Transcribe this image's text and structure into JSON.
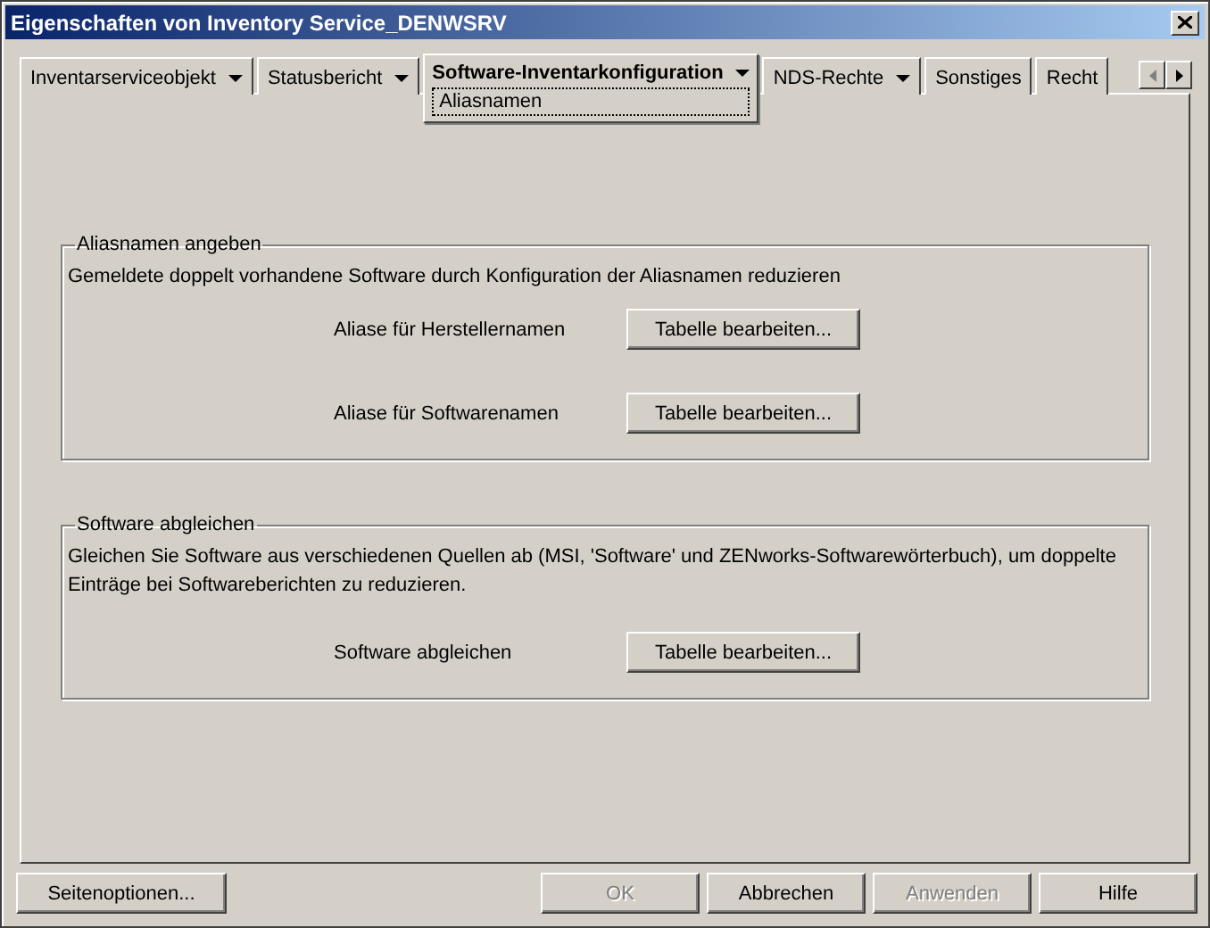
{
  "window": {
    "title": "Eigenschaften von Inventory Service_DENWSRV"
  },
  "tabs": [
    {
      "label": "Inventarserviceobjekt",
      "selected": false,
      "dropdown": true
    },
    {
      "label": "Statusbericht",
      "selected": false,
      "dropdown": true
    },
    {
      "label": "Software-Inventarkonfiguration",
      "selected": true,
      "dropdown": true,
      "subpages": [
        "Aliasnamen"
      ]
    },
    {
      "label": "NDS-Rechte",
      "selected": false,
      "dropdown": true
    },
    {
      "label": "Sonstiges",
      "selected": false,
      "dropdown": false
    },
    {
      "label": "Recht",
      "selected": false,
      "dropdown": false
    }
  ],
  "groups": [
    {
      "title": "Aliasnamen angeben",
      "description": "Gemeldete doppelt vorhandene Software durch Konfiguration der Aliasnamen reduzieren",
      "rows": [
        {
          "label": "Aliase für Herstellernamen",
          "button": "Tabelle bearbeiten..."
        },
        {
          "label": "Aliase für Softwarenamen",
          "button": "Tabelle bearbeiten..."
        }
      ]
    },
    {
      "title": "Software abgleichen",
      "description": "Gleichen Sie Software aus verschiedenen Quellen ab (MSI, 'Software' und ZENworks-Softwarewörterbuch), um doppelte Einträge bei Softwareberichten zu reduzieren.",
      "rows": [
        {
          "label": "Software abgleichen",
          "button": "Tabelle bearbeiten..."
        }
      ]
    }
  ],
  "page_options_button": {
    "label": "Seitenoptionen..."
  },
  "buttons": [
    {
      "label": "OK",
      "disabled": true
    },
    {
      "label": "Abbrechen",
      "disabled": false
    },
    {
      "label": "Anwenden",
      "disabled": true
    },
    {
      "label": "Hilfe",
      "disabled": false
    }
  ]
}
